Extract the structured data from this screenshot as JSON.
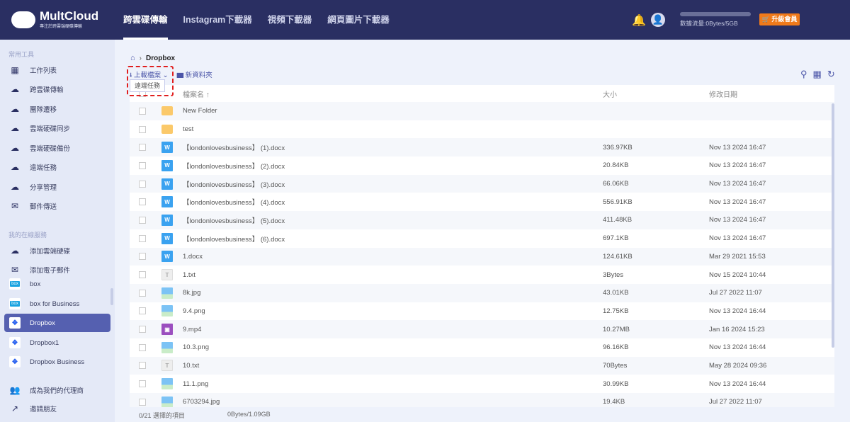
{
  "header": {
    "brand": "MultCloud",
    "tagline": "專注於跨雲端硬碟傳輸",
    "nav": [
      "跨雲碟傳輸",
      "Instagram下載器",
      "視頻下載器",
      "網頁圖片下載器"
    ],
    "quota_text": "數據流量:0Bytes/5GB",
    "quota_used": 0,
    "upgrade": "升級會員"
  },
  "sidebar": {
    "common_title": "常用工具",
    "common": [
      "工作列表",
      "跨雲碟傳輸",
      "團隊遷移",
      "雲端硬碟同步",
      "雲端硬碟備份",
      "遠端任務",
      "分享管理",
      "郵件傳送"
    ],
    "services_title": "我的在線服務",
    "services": [
      "添加雲端硬碟",
      "添加電子郵件"
    ],
    "drives": [
      "box",
      "box for Business",
      "Dropbox",
      "Dropbox1",
      "Dropbox Business"
    ],
    "bottom": [
      "成為我們的代理商",
      "邀請朋友"
    ]
  },
  "breadcrumb": {
    "current": "Dropbox"
  },
  "toolbar": {
    "upload": "上載檔案",
    "new_folder": "新資料夾",
    "dropdown_item": "遠端任務"
  },
  "table": {
    "headers": {
      "name": "檔案名",
      "size": "大小",
      "date": "修改日期"
    },
    "rows": [
      {
        "type": "folder",
        "name": "New Folder",
        "size": "",
        "date": ""
      },
      {
        "type": "folder",
        "name": "test",
        "size": "",
        "date": ""
      },
      {
        "type": "docx",
        "name": "【londonlovesbusiness】 (1).docx",
        "size": "336.97KB",
        "date": "Nov 13 2024 16:47"
      },
      {
        "type": "docx",
        "name": "【londonlovesbusiness】 (2).docx",
        "size": "20.84KB",
        "date": "Nov 13 2024 16:47"
      },
      {
        "type": "docx",
        "name": "【londonlovesbusiness】 (3).docx",
        "size": "66.06KB",
        "date": "Nov 13 2024 16:47"
      },
      {
        "type": "docx",
        "name": "【londonlovesbusiness】 (4).docx",
        "size": "556.91KB",
        "date": "Nov 13 2024 16:47"
      },
      {
        "type": "docx",
        "name": "【londonlovesbusiness】 (5).docx",
        "size": "411.48KB",
        "date": "Nov 13 2024 16:47"
      },
      {
        "type": "docx",
        "name": "【londonlovesbusiness】 (6).docx",
        "size": "697.1KB",
        "date": "Nov 13 2024 16:47"
      },
      {
        "type": "docx",
        "name": "1.docx",
        "size": "124.61KB",
        "date": "Mar 29 2021 15:53"
      },
      {
        "type": "txt",
        "name": "1.txt",
        "size": "3Bytes",
        "date": "Nov 15 2024 10:44"
      },
      {
        "type": "img",
        "name": "8k.jpg",
        "size": "43.01KB",
        "date": "Jul 27 2022 11:07"
      },
      {
        "type": "img",
        "name": "9.4.png",
        "size": "12.75KB",
        "date": "Nov 13 2024 16:44"
      },
      {
        "type": "vid",
        "name": "9.mp4",
        "size": "10.27MB",
        "date": "Jan 16 2024 15:23"
      },
      {
        "type": "img",
        "name": "10.3.png",
        "size": "96.16KB",
        "date": "Nov 13 2024 16:44"
      },
      {
        "type": "txt",
        "name": "10.txt",
        "size": "70Bytes",
        "date": "May 28 2024 09:36"
      },
      {
        "type": "img",
        "name": "11.1.png",
        "size": "30.99KB",
        "date": "Nov 13 2024 16:44"
      },
      {
        "type": "img",
        "name": "6703294.jpg",
        "size": "19.4KB",
        "date": "Jul 27 2022 11:07"
      }
    ]
  },
  "footer": {
    "selected": "0/21 選擇的項目",
    "size": "0Bytes/1.09GB"
  }
}
